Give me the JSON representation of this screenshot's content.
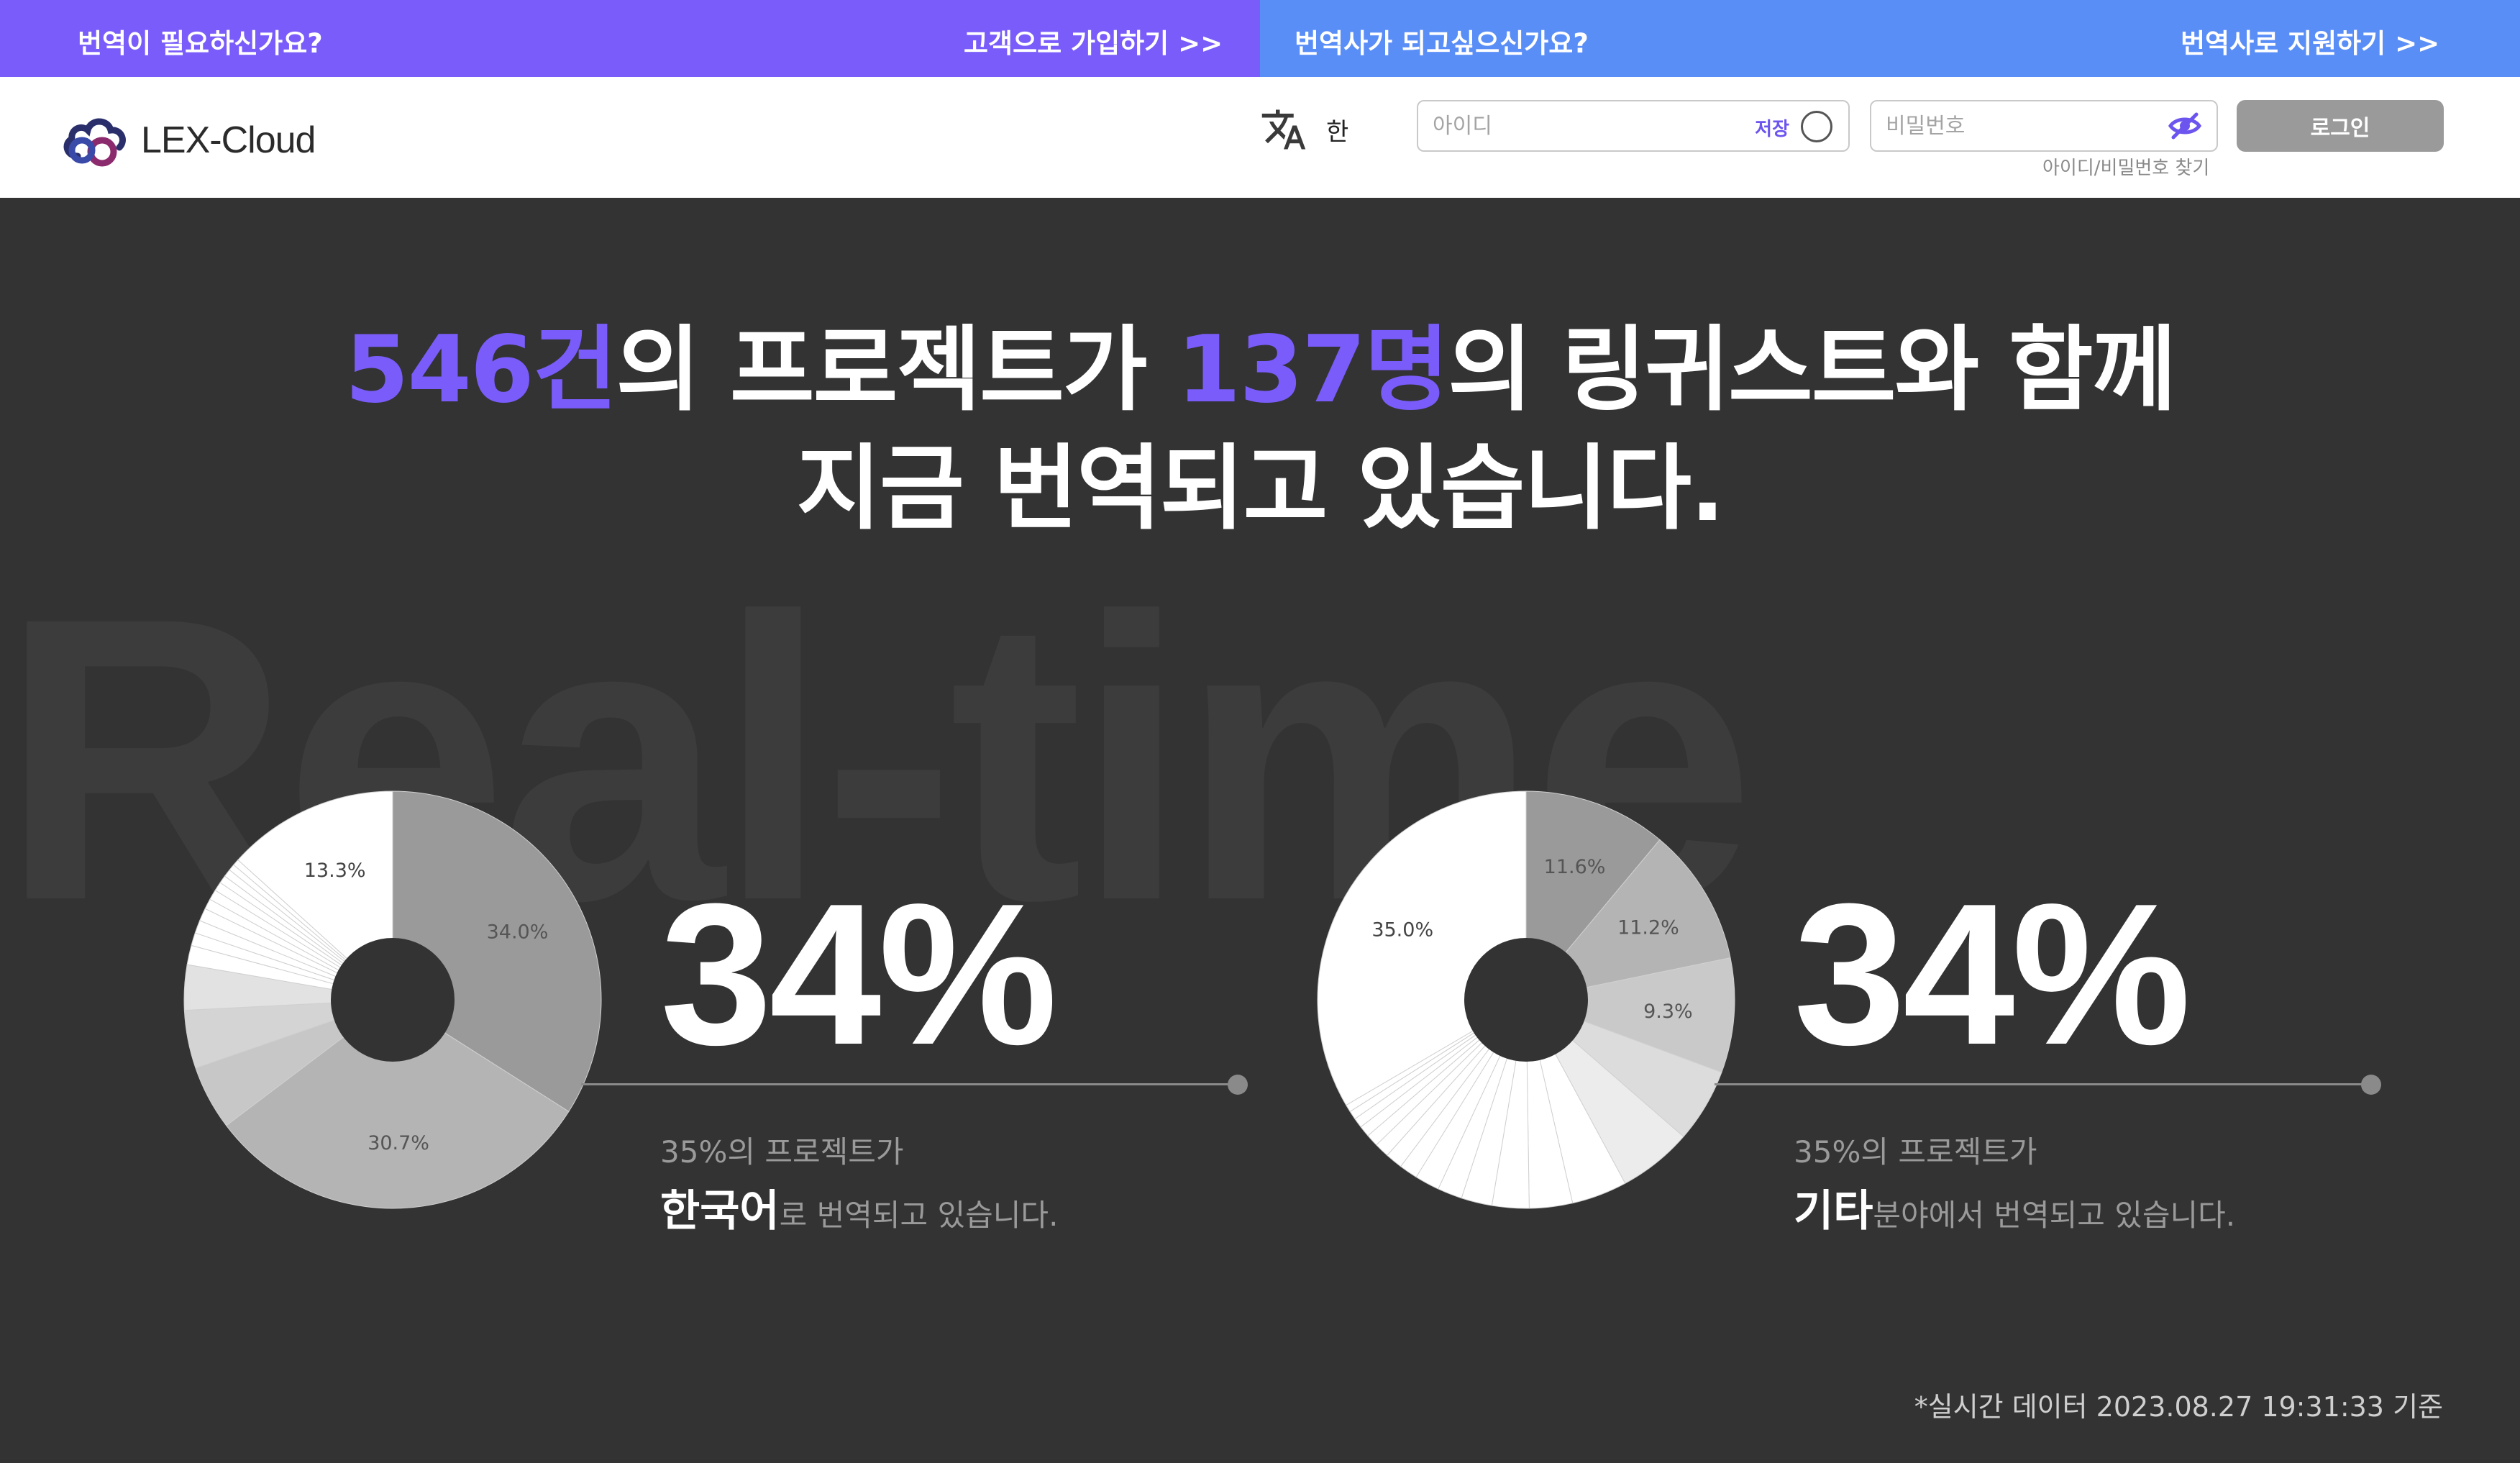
{
  "topbar": {
    "customer_question": "번역이 필요하신가요?",
    "customer_link": "고객으로 가입하기 >>",
    "translator_question": "번역사가 되고싶으신가요?",
    "translator_link": "번역사로 지원하기 >>"
  },
  "header": {
    "logo_text": "LEX-Cloud",
    "language_label": "한",
    "id_placeholder": "아이디",
    "save_label": "저장",
    "password_placeholder": "비밀번호",
    "login_label": "로그인",
    "find_account_label": "아이디/비밀번호 찾기"
  },
  "hero": {
    "project_count": "546건",
    "text_a": "의 프로젝트가 ",
    "linguist_count": "137명",
    "text_b": "의 링귀스트와 함께",
    "line2": "지금 번역되고 있습니다.",
    "watermark": "Real-time"
  },
  "stats": [
    {
      "big_percent": "34%",
      "line1": "35%의 프로젝트가",
      "highlight": "한국어",
      "line2_rest": "로 번역되고 있습니다."
    },
    {
      "big_percent": "34%",
      "line1": "35%의 프로젝트가",
      "highlight": "기타",
      "line2_rest": "분야에서 번역되고 있습니다."
    }
  ],
  "footnote": "*실시간 데이터 2023.08.27 19:31:33 기준",
  "chart_data": [
    {
      "type": "pie",
      "donut": true,
      "categories": [
        "",
        "",
        "",
        "",
        "",
        "",
        "",
        "",
        "",
        "",
        "",
        "",
        "",
        "",
        "",
        "",
        ""
      ],
      "values": [
        34.0,
        30.7,
        5.0,
        4.5,
        3.5,
        1.5,
        1.0,
        1.0,
        1.0,
        0.8,
        0.8,
        0.7,
        0.6,
        0.6,
        0.5,
        0.5,
        13.3
      ],
      "labels": [
        "34.0%",
        "30.7%",
        "",
        "",
        "",
        "",
        "",
        "",
        "",
        "",
        "",
        "",
        "",
        "",
        "",
        "",
        "13.3%"
      ],
      "colors": [
        "#9a9a9a",
        "#b4b4b4",
        "#c7c7c7",
        "#d4d4d4",
        "#e2e2e2",
        "#ffffff",
        "#ffffff",
        "#ffffff",
        "#ffffff",
        "#ffffff",
        "#ffffff",
        "#ffffff",
        "#ffffff",
        "#ffffff",
        "#ffffff",
        "#ffffff",
        "#ffffff"
      ]
    },
    {
      "type": "pie",
      "donut": true,
      "categories": [
        "",
        "",
        "",
        "",
        "",
        "",
        "",
        "",
        "",
        "",
        "",
        "",
        "",
        "",
        "",
        "",
        "",
        "",
        "",
        ""
      ],
      "values": [
        11.6,
        11.2,
        9.3,
        6.0,
        6.0,
        4.5,
        3.5,
        3.0,
        2.5,
        2.0,
        2.0,
        1.5,
        1.4,
        1.2,
        1.0,
        0.9,
        0.8,
        0.7,
        0.6,
        35.0
      ],
      "labels": [
        "11.6%",
        "11.2%",
        "9.3%",
        "",
        "",
        "",
        "",
        "",
        "",
        "",
        "",
        "",
        "",
        "",
        "",
        "",
        "",
        "",
        "",
        "35.0%"
      ],
      "colors": [
        "#9a9a9a",
        "#b4b4b4",
        "#c9c9c9",
        "#dcdcdc",
        "#ececec",
        "#ffffff",
        "#ffffff",
        "#ffffff",
        "#ffffff",
        "#ffffff",
        "#ffffff",
        "#ffffff",
        "#ffffff",
        "#ffffff",
        "#ffffff",
        "#ffffff",
        "#ffffff",
        "#ffffff",
        "#ffffff",
        "#ffffff"
      ]
    }
  ]
}
